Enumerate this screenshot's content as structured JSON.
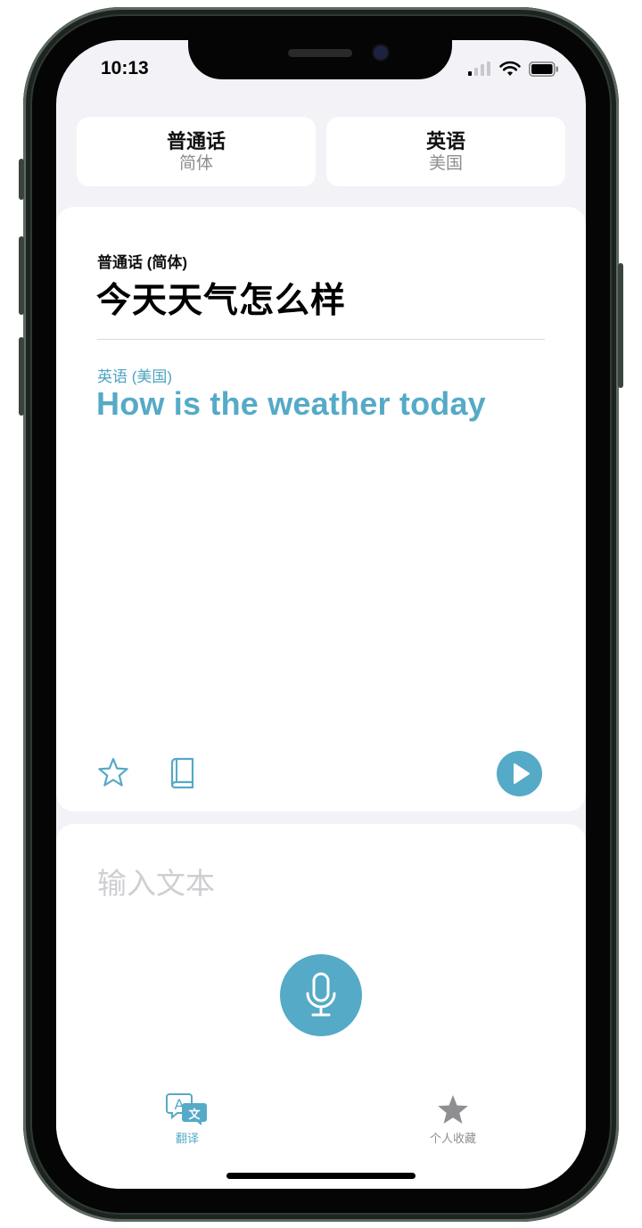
{
  "status_bar": {
    "time": "10:13"
  },
  "languages": {
    "source": {
      "name": "普通话",
      "variant": "简体"
    },
    "target": {
      "name": "英语",
      "variant": "美国"
    }
  },
  "translation": {
    "source_label": "普通话 (简体)",
    "source_text": "今天天气怎么样",
    "target_label": "英语 (美国)",
    "target_text": "How is the weather today"
  },
  "input": {
    "placeholder": "输入文本"
  },
  "tabs": [
    {
      "label": "翻译",
      "active": true
    },
    {
      "label": "个人收藏",
      "active": false
    }
  ],
  "colors": {
    "accent": "#55aac7",
    "background": "#f2f2f7",
    "inactive": "#8e8e93"
  },
  "icons": [
    "star-icon",
    "dictionary-book-icon",
    "play-icon",
    "microphone-icon",
    "translate-icon",
    "favorites-star-icon"
  ]
}
